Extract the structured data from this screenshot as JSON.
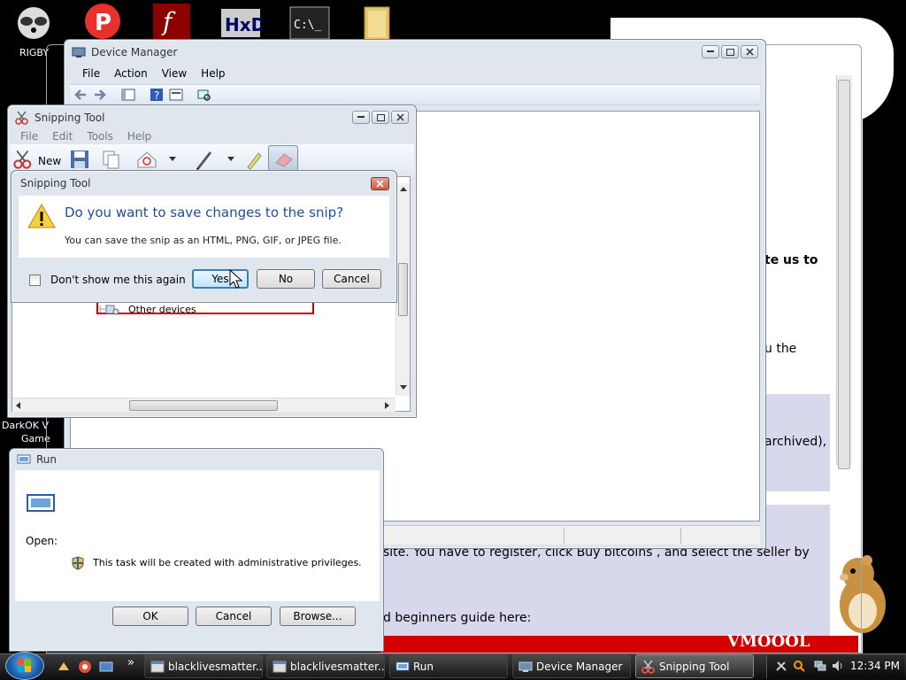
{
  "desktop": {
    "icons": [
      {
        "label": "RIGBY"
      },
      {
        "label": "DarkOK V"
      },
      {
        "label": "Game"
      }
    ],
    "background_texts": [
      "te us to",
      "u the",
      "archived),",
      "site. You have to register, click  Buy bitcoins , and select the seller by",
      "d beginners guide here:"
    ]
  },
  "device_manager": {
    "title": "Device Manager",
    "menu": [
      "File",
      "Action",
      "View",
      "Help"
    ]
  },
  "snipping_tool": {
    "title": "Snipping Tool",
    "menu": [
      "File",
      "Edit",
      "Tools",
      "Help"
    ],
    "new_label": "New",
    "tree_item": "Other devices"
  },
  "dialog": {
    "title": "Snipping Tool",
    "question": "Do you want to save changes to the snip?",
    "detail": "You can save the snip as an HTML, PNG, GIF, or JPEG file.",
    "checkbox_label": "Don't show me this again",
    "yes": "Yes",
    "no": "No",
    "cancel": "Cancel"
  },
  "run_dialog": {
    "title": "Run",
    "open_label": "Open:",
    "admin_note": "This task will be created with administrative privileges.",
    "ok": "OK",
    "cancel": "Cancel",
    "browse": "Browse..."
  },
  "taskbar": {
    "buttons": [
      {
        "label": "blacklivesmatter..."
      },
      {
        "label": "blacklivesmatter..."
      },
      {
        "label": "Run"
      },
      {
        "label": "Device Manager"
      },
      {
        "label": "Snipping Tool"
      }
    ],
    "clock": "12:34 PM",
    "quicklaunch_more": "»"
  },
  "colors": {
    "title_glass": "#dfe6ee",
    "accent_link": "#1f4e9c",
    "selection_red": "#cc0000",
    "page_lavender": "#d8d8ec"
  }
}
